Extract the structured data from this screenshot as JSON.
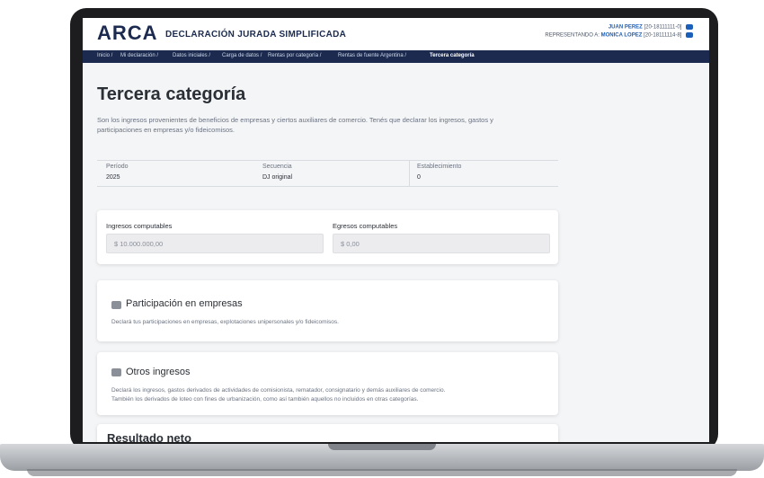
{
  "header": {
    "logo": "ARCA",
    "subtitle": "DECLARACIÓN JURADA SIMPLIFICADA",
    "user_name": "JUAN PEREZ",
    "user_cuit": "[20-18111111-0]",
    "represented_prefix": "REPRESENTANDO A:",
    "represented_name": "MONICA LOPEZ",
    "represented_cuit": "[20-18111114-8]"
  },
  "breadcrumb": [
    "Inicio /",
    "Mi declaración /",
    "Datos iniciales /",
    "Carga de datos /",
    "Rentas por categoría /",
    "Rentas de fuente Argentina /",
    "Tercera categoría"
  ],
  "page": {
    "title": "Tercera categoría",
    "description": "Son los ingresos provenientes de beneficios de empresas y ciertos auxiliares de comercio. Tenés que declarar los ingresos, gastos y participaciones en empresas y/o fideicomisos."
  },
  "info": {
    "periodo_label": "Período",
    "periodo_value": "2025",
    "secuencia_label": "Secuencia",
    "secuencia_value": "DJ original",
    "establecimiento_label": "Establecimiento",
    "establecimiento_value": "0"
  },
  "computables": {
    "ingresos_label": "Ingresos computables",
    "ingresos_value": "$ 10.000.000,00",
    "egresos_label": "Egresos computables",
    "egresos_value": "$ 0,00"
  },
  "participacion": {
    "title": "Participación en empresas",
    "description": "Declará tus participaciones en empresas, explotaciones unipersonales y/o fideicomisos."
  },
  "otros": {
    "title": "Otros ingresos",
    "description_1": "Declará los ingresos, gastos derivados de actividades de comisionista, rematador, consignatario y demás auxiliares de comercio.",
    "description_2": "También los derivados de loteo con fines de urbanización, como así también aquellos no incluidos en otras categorías."
  },
  "resultado": {
    "title": "Resultado neto"
  }
}
